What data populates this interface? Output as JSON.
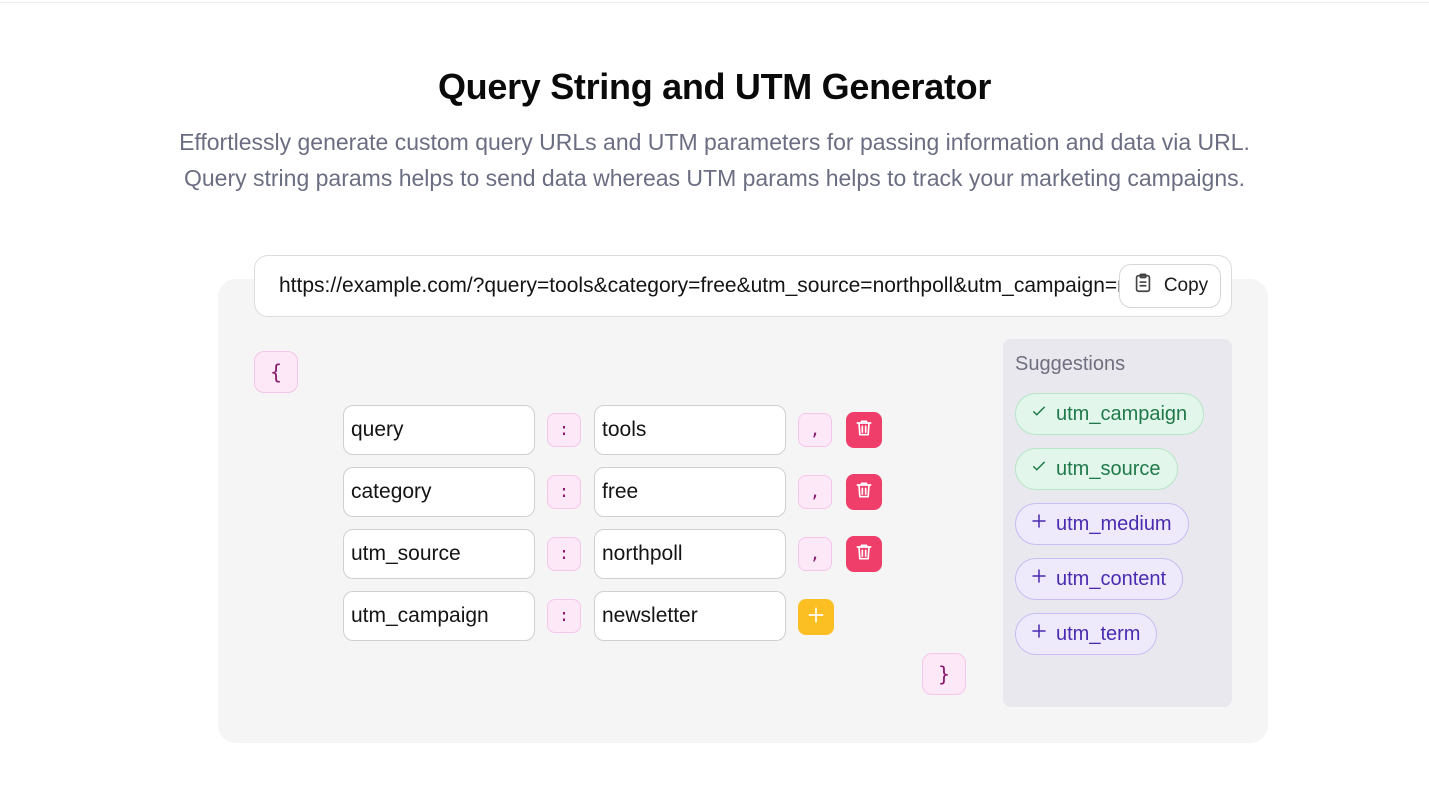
{
  "page": {
    "title": "Query String and UTM Generator",
    "subtitle_line1": "Effortlessly generate custom query URLs and UTM parameters for passing information and data via URL.",
    "subtitle_line2": "Query string params helps to send data whereas UTM params helps to track your marketing campaigns."
  },
  "output": {
    "url": "https://example.com/?query=tools&category=free&utm_source=northpoll&utm_campaign=newsletter",
    "copy_label": "Copy",
    "copy_icon": "clipboard-icon"
  },
  "editor": {
    "open_brace": "{",
    "close_brace": "}",
    "colon": ":",
    "comma": ",",
    "rows": [
      {
        "key": "query",
        "value": "tools"
      },
      {
        "key": "category",
        "value": "free"
      },
      {
        "key": "utm_source",
        "value": "northpoll"
      },
      {
        "key": "utm_campaign",
        "value": "newsletter"
      }
    ],
    "delete_icon": "trash-icon",
    "add_icon": "plus-icon"
  },
  "suggestions": {
    "title": "Suggestions",
    "items": [
      {
        "label": "utm_campaign",
        "state": "added",
        "icon": "check-icon"
      },
      {
        "label": "utm_source",
        "state": "added",
        "icon": "check-icon"
      },
      {
        "label": "utm_medium",
        "state": "available",
        "icon": "plus-icon"
      },
      {
        "label": "utm_content",
        "state": "available",
        "icon": "plus-icon"
      },
      {
        "label": "utm_term",
        "state": "available",
        "icon": "plus-icon"
      }
    ]
  },
  "colors": {
    "delete": "#f03e6a",
    "add": "#fbbf24",
    "added_chip": "#e3f6eb",
    "available_chip": "#eeeafb",
    "brace": "#fde8f7"
  }
}
